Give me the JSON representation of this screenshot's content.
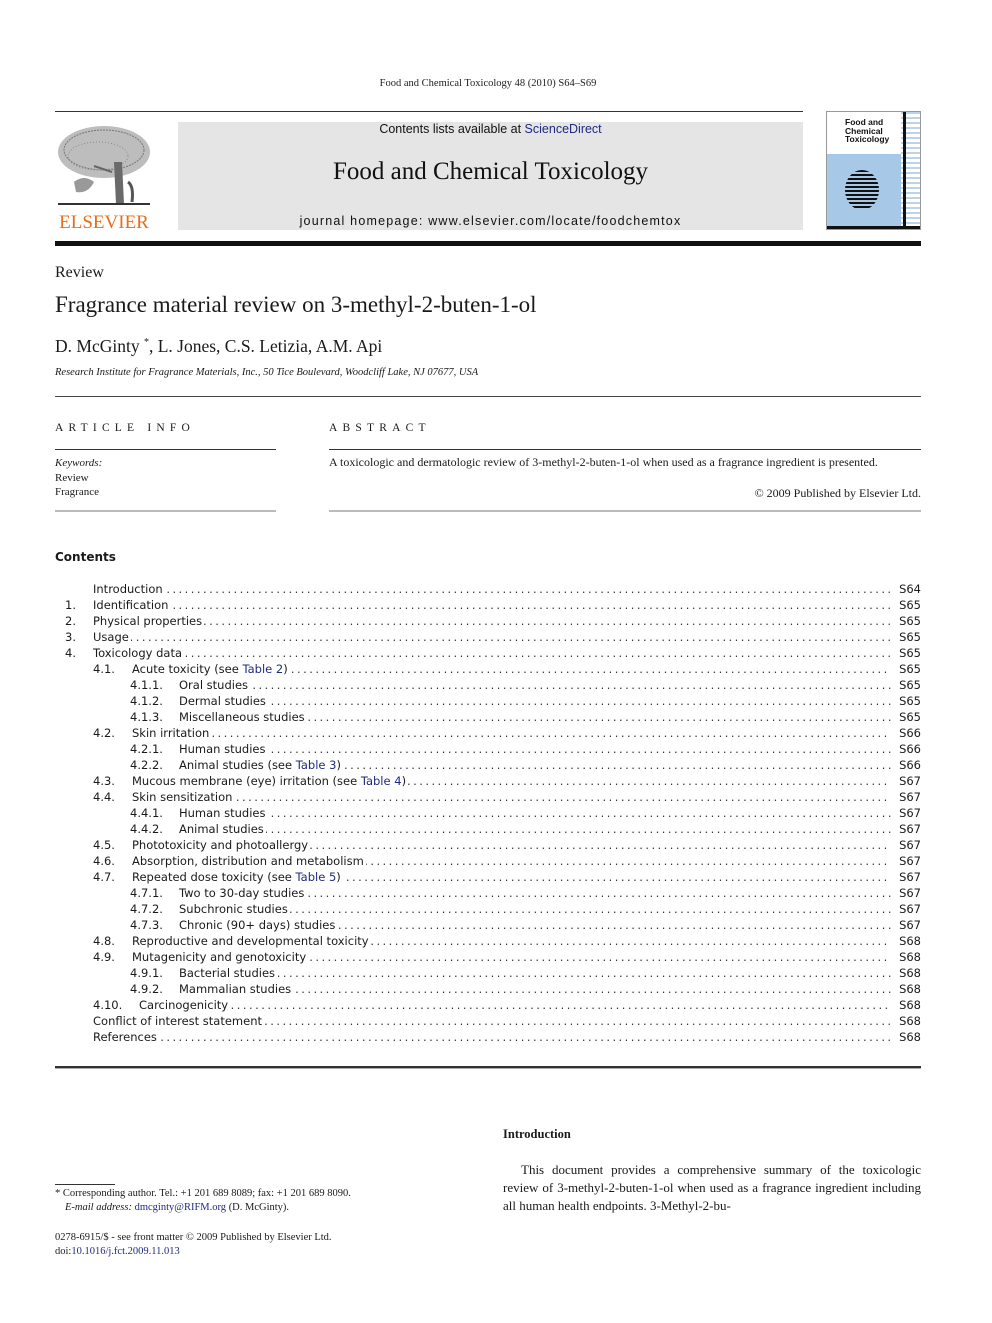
{
  "running_head": "Food and Chemical Toxicology 48 (2010) S64–S69",
  "publisher": {
    "logo_word": "ELSEVIER",
    "logo_color": "#e86c1a"
  },
  "masthead": {
    "contents_prefix": "Contents lists available at ",
    "contents_link": "ScienceDirect",
    "journal_name": "Food and Chemical Toxicology",
    "homepage": "journal homepage: www.elsevier.com/locate/foodchemtox"
  },
  "cover": {
    "title_lines": [
      "Food and",
      "Chemical",
      "Toxicology"
    ]
  },
  "article": {
    "type": "Review",
    "title": "Fragrance material review on 3-methyl-2-buten-1-ol",
    "authors": [
      {
        "name": "D. McGinty",
        "mark": "*"
      },
      {
        "name": "L. Jones"
      },
      {
        "name": "C.S. Letizia"
      },
      {
        "name": "A.M. Api"
      }
    ],
    "affiliation": "Research Institute for Fragrance Materials, Inc., 50 Tice Boulevard, Woodcliff Lake, NJ 07677, USA"
  },
  "article_info": {
    "heading": "ARTICLE INFO",
    "keywords_label": "Keywords:",
    "keywords": [
      "Review",
      "Fragrance"
    ]
  },
  "abstract": {
    "heading": "ABSTRACT",
    "text": "A toxicologic and dermatologic review of 3-methyl-2-buten-1-ol when used as a fragrance ingredient is presented.",
    "copyright": "© 2009 Published by Elsevier Ltd."
  },
  "contents": {
    "heading": "Contents",
    "items": [
      {
        "level": 1,
        "num": "",
        "title": "Introduction",
        "link": "",
        "suffix": "",
        "page": "S64"
      },
      {
        "level": 1,
        "num": "1.",
        "title": "Identification",
        "link": "",
        "suffix": "",
        "page": "S65"
      },
      {
        "level": 1,
        "num": "2.",
        "title": "Physical properties",
        "link": "",
        "suffix": "",
        "page": "S65"
      },
      {
        "level": 1,
        "num": "3.",
        "title": "Usage",
        "link": "",
        "suffix": "",
        "page": "S65"
      },
      {
        "level": 1,
        "num": "4.",
        "title": "Toxicology data",
        "link": "",
        "suffix": "",
        "page": "S65"
      },
      {
        "level": 2,
        "num": "4.1.",
        "title": "Acute toxicity (see ",
        "link": "Table 2",
        "suffix": ")",
        "page": "S65"
      },
      {
        "level": 3,
        "num": "4.1.1.",
        "title": "Oral studies",
        "link": "",
        "suffix": "",
        "page": "S65"
      },
      {
        "level": 3,
        "num": "4.1.2.",
        "title": "Dermal studies",
        "link": "",
        "suffix": "",
        "page": "S65"
      },
      {
        "level": 3,
        "num": "4.1.3.",
        "title": "Miscellaneous studies",
        "link": "",
        "suffix": "",
        "page": "S65"
      },
      {
        "level": 2,
        "num": "4.2.",
        "title": "Skin irritation",
        "link": "",
        "suffix": "",
        "page": "S66"
      },
      {
        "level": 3,
        "num": "4.2.1.",
        "title": "Human studies",
        "link": "",
        "suffix": "",
        "page": "S66"
      },
      {
        "level": 3,
        "num": "4.2.2.",
        "title": "Animal studies (see ",
        "link": "Table 3",
        "suffix": ")",
        "page": "S66"
      },
      {
        "level": 2,
        "num": "4.3.",
        "title": "Mucous membrane (eye) irritation (see ",
        "link": "Table 4",
        "suffix": ")",
        "page": "S67"
      },
      {
        "level": 2,
        "num": "4.4.",
        "title": "Skin sensitization",
        "link": "",
        "suffix": "",
        "page": "S67"
      },
      {
        "level": 3,
        "num": "4.4.1.",
        "title": "Human studies",
        "link": "",
        "suffix": "",
        "page": "S67"
      },
      {
        "level": 3,
        "num": "4.4.2.",
        "title": "Animal studies",
        "link": "",
        "suffix": "",
        "page": "S67"
      },
      {
        "level": 2,
        "num": "4.5.",
        "title": "Phototoxicity and photoallergy",
        "link": "",
        "suffix": "",
        "page": "S67"
      },
      {
        "level": 2,
        "num": "4.6.",
        "title": "Absorption, distribution and metabolism",
        "link": "",
        "suffix": "",
        "page": "S67"
      },
      {
        "level": 2,
        "num": "4.7.",
        "title": "Repeated dose toxicity (see ",
        "link": "Table 5",
        "suffix": ")",
        "page": "S67"
      },
      {
        "level": 3,
        "num": "4.7.1.",
        "title": "Two to 30-day studies",
        "link": "",
        "suffix": "",
        "page": "S67"
      },
      {
        "level": 3,
        "num": "4.7.2.",
        "title": "Subchronic studies",
        "link": "",
        "suffix": "",
        "page": "S67"
      },
      {
        "level": 3,
        "num": "4.7.3.",
        "title": "Chronic (90+ days) studies",
        "link": "",
        "suffix": "",
        "page": "S67"
      },
      {
        "level": 2,
        "num": "4.8.",
        "title": "Reproductive and developmental toxicity",
        "link": "",
        "suffix": "",
        "page": "S68"
      },
      {
        "level": 2,
        "num": "4.9.",
        "title": "Mutagenicity and genotoxicity",
        "link": "",
        "suffix": "",
        "page": "S68"
      },
      {
        "level": 3,
        "num": "4.9.1.",
        "title": "Bacterial studies",
        "link": "",
        "suffix": "",
        "page": "S68"
      },
      {
        "level": 3,
        "num": "4.9.2.",
        "title": "Mammalian studies",
        "link": "",
        "suffix": "",
        "page": "S68"
      },
      {
        "level": "2w",
        "num": "4.10.",
        "title": "Carcinogenicity",
        "link": "",
        "suffix": "",
        "page": "S68"
      },
      {
        "level": 1,
        "num": "",
        "title": "Conflict of interest statement",
        "link": "",
        "suffix": "",
        "page": "S68"
      },
      {
        "level": 1,
        "num": "",
        "title": "References",
        "link": "",
        "suffix": "",
        "page": "S68"
      }
    ]
  },
  "footnote": {
    "mark": "*",
    "text": "Corresponding author. Tel.: +1 201 689 8089; fax: +1 201 689 8090.",
    "email_label": "E-mail address:",
    "email": "dmcginty@RIFM.org",
    "email_suffix": "(D. McGinty)."
  },
  "issn_line": "0278-6915/$ - see front matter © 2009 Published by Elsevier Ltd.",
  "doi_prefix": "doi:",
  "doi": "10.1016/j.fct.2009.11.013",
  "introduction": {
    "heading": "Introduction",
    "text": "This document provides a comprehensive summary of the toxicologic review of 3-methyl-2-buten-1-ol when used as a fragrance ingredient including all human health endpoints. 3-Methyl-2-bu-"
  }
}
